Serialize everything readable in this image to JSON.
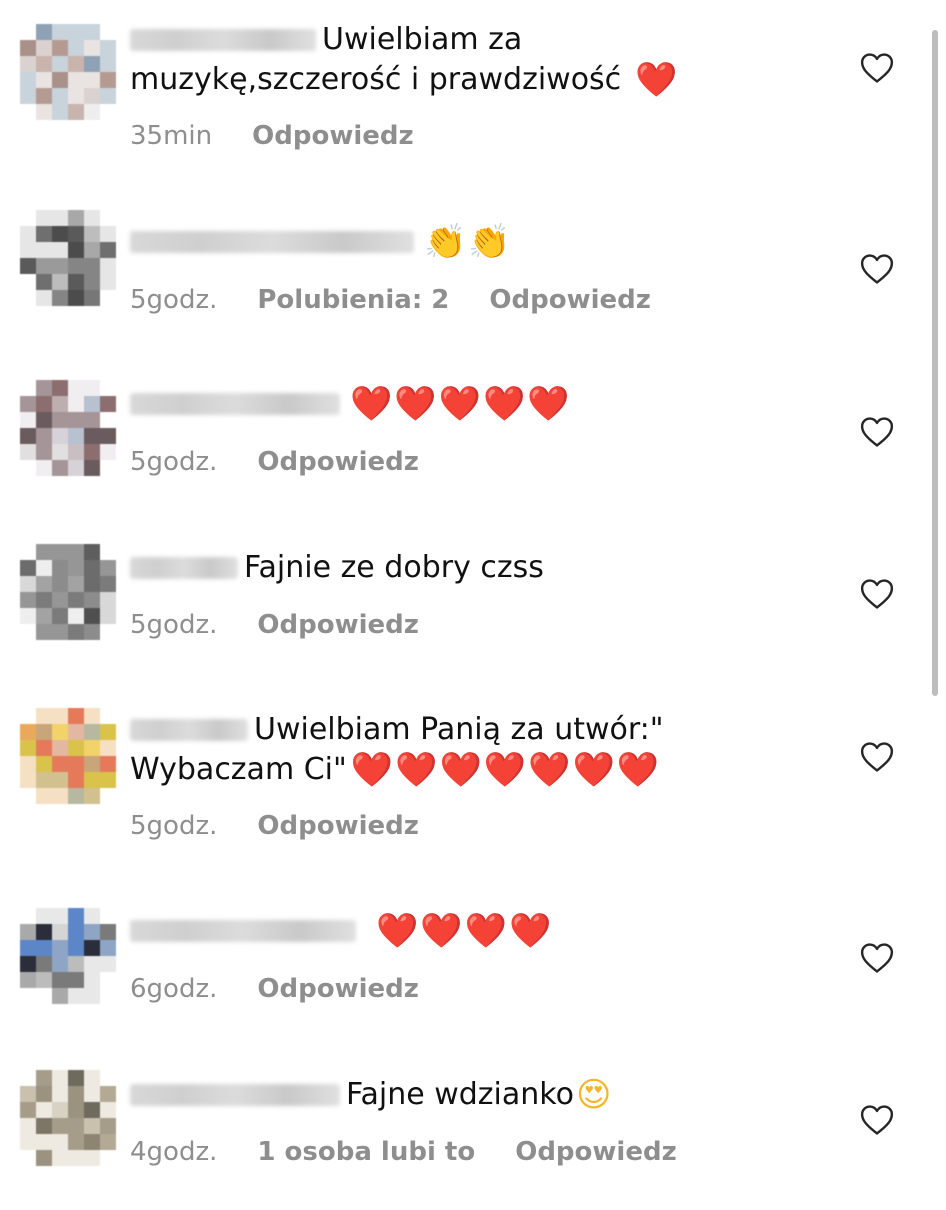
{
  "comments": [
    {
      "text_line1": "Uwielbiam za",
      "text_line2": "muzykę,szczerość i prawdziwość",
      "emoji": "❤️",
      "time": "35min",
      "likes": "",
      "reply": "Odpowiedz"
    },
    {
      "text_line1": "",
      "emoji": "👏👏",
      "time": "5godz.",
      "likes": "Polubienia: 2",
      "reply": "Odpowiedz"
    },
    {
      "text_line1": "",
      "emoji": "❤️❤️❤️❤️❤️",
      "time": "5godz.",
      "likes": "",
      "reply": "Odpowiedz"
    },
    {
      "text_line1": "Fajnie ze dobry czss",
      "emoji": "",
      "time": "5godz.",
      "likes": "",
      "reply": "Odpowiedz"
    },
    {
      "text_line1": "Uwielbiam Panią za utwór:\"",
      "text_line2": "Wybaczam Ci\"",
      "emoji": "❤️❤️❤️❤️❤️❤️❤️",
      "time": "5godz.",
      "likes": "",
      "reply": "Odpowiedz"
    },
    {
      "text_line1": "",
      "emoji": "❤️❤️❤️❤️",
      "time": "6godz.",
      "likes": "",
      "reply": "Odpowiedz"
    },
    {
      "text_line1": "Fajne wdzianko",
      "emoji": "😍",
      "time": "4godz.",
      "likes": "1 osoba lubi to",
      "reply": "Odpowiedz"
    }
  ],
  "colors": {
    "meta_text": "#8e8e8e",
    "heart_outline": "#262626",
    "heart_emoji": "#e8262d"
  },
  "icons": {
    "like": "heart-outline-icon"
  }
}
